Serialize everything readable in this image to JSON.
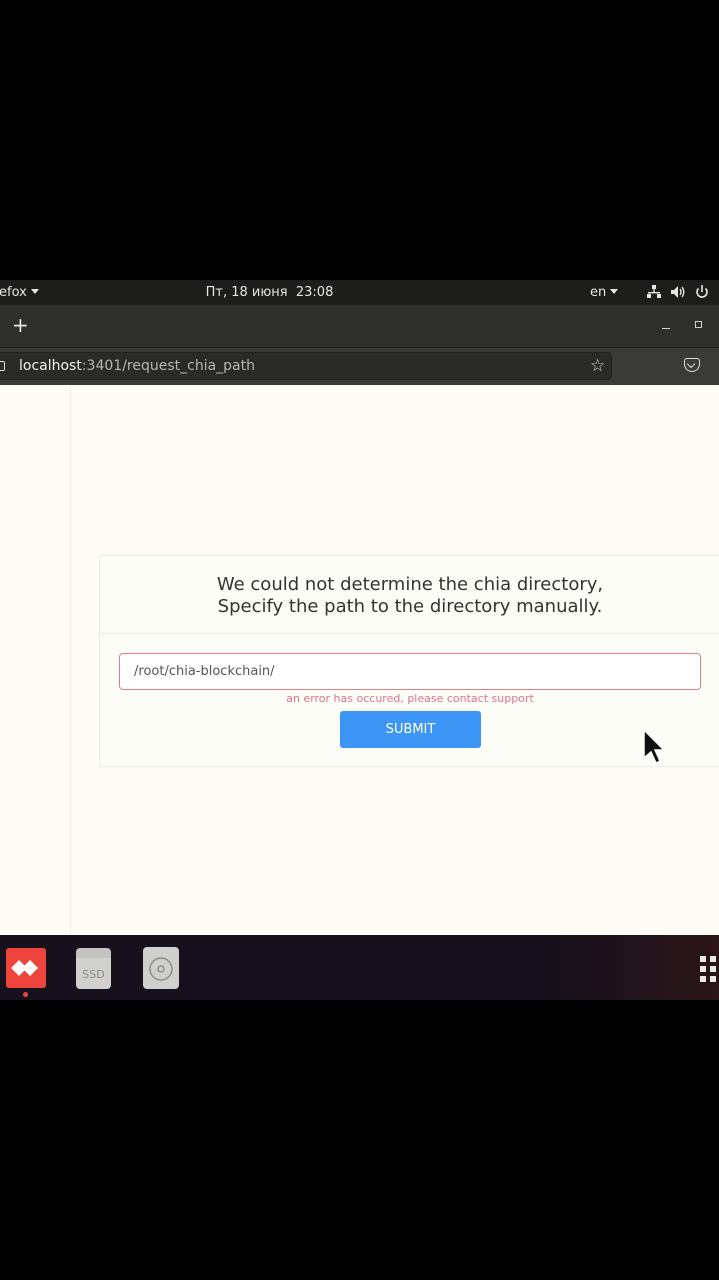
{
  "system_bar": {
    "app_menu": "efox",
    "clock": "Пт, 18 июня  23:08",
    "language": "en"
  },
  "browser": {
    "new_tab": "+",
    "url_host": "localhost",
    "url_rest": ":3401/request_chia_path"
  },
  "page": {
    "title_line1": "We could not determine the chia directory,",
    "title_line2": "Specify the path to the directory manually.",
    "path_value": "/root/chia-blockchain/",
    "error_message": "an error has occured, please contact support",
    "submit_label": "SUBMIT",
    "accent_color": "#3d95f5",
    "error_color": "#e07585"
  },
  "dock": {
    "ssd_label": "SSD"
  }
}
